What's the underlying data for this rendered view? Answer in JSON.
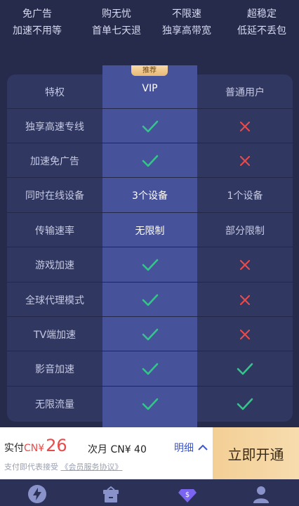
{
  "benefits": [
    {
      "title": "免广告",
      "subtitle": "加速不用等"
    },
    {
      "title": "购无忧",
      "subtitle": "首单七天退"
    },
    {
      "title": "不限速",
      "subtitle": "独享高带宽"
    },
    {
      "title": "超稳定",
      "subtitle": "低延不丢包"
    }
  ],
  "table": {
    "badge": "推荐",
    "header": {
      "feature": "特权",
      "vip": "VIP",
      "normal": "普通用户"
    },
    "rows": [
      {
        "feature": "独享高速专线",
        "vip": "check",
        "normal": "cross"
      },
      {
        "feature": "加速免广告",
        "vip": "check",
        "normal": "cross"
      },
      {
        "feature": "同时在线设备",
        "vip": "3个设备",
        "normal": "1个设备"
      },
      {
        "feature": "传输速率",
        "vip": "无限制",
        "normal": "部分限制"
      },
      {
        "feature": "游戏加速",
        "vip": "check",
        "normal": "cross"
      },
      {
        "feature": "全球代理模式",
        "vip": "check",
        "normal": "cross"
      },
      {
        "feature": "TV端加速",
        "vip": "check",
        "normal": "cross"
      },
      {
        "feature": "影音加速",
        "vip": "check",
        "normal": "check"
      },
      {
        "feature": "无限流量",
        "vip": "check",
        "normal": "check"
      }
    ]
  },
  "paybar": {
    "paid_label": "实付",
    "currency": "CN¥",
    "amount": "26",
    "next_month": "次月 CN¥ 40",
    "detail_label": "明细",
    "agreement_prefix": "支付即代表接受",
    "agreement_link": "《会员服务协议》",
    "open_button": "立即开通"
  },
  "nav": {
    "items": [
      "lightning-icon",
      "gift-icon",
      "vip-diamond-icon",
      "user-icon"
    ]
  },
  "colors": {
    "background": "#262b4c",
    "card": "#303761",
    "vip_column": "#46529a",
    "check": "#35c48a",
    "cross": "#e84b4b",
    "price": "#e84b4b",
    "open_button": "#f3cf95"
  }
}
